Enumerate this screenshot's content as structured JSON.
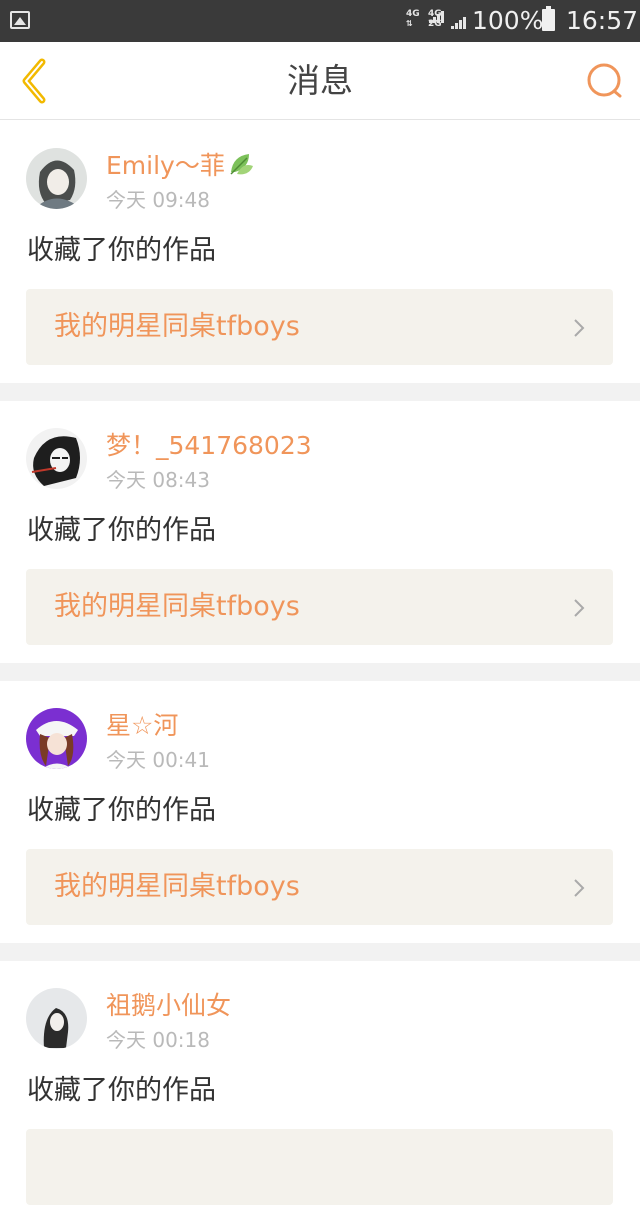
{
  "status_bar": {
    "network_1": "4G",
    "network_2_top": "4G",
    "network_2_bottom": "2G",
    "battery_percent": "100%",
    "time": "16:57",
    "icons": [
      "gallery-icon",
      "signal-icon",
      "battery-icon"
    ]
  },
  "header": {
    "title": "消息",
    "back_icon": "chevron-left-icon",
    "search_icon": "search-icon",
    "accent_color": "#f0955a",
    "back_color": "#f2b900"
  },
  "messages": [
    {
      "username": "Emily～菲",
      "username_emoji": "leaf-icon",
      "time": "今天 09:48",
      "action": "收藏了你的作品",
      "work_title": "我的明星同桌tfboys"
    },
    {
      "username": "梦！_541768023",
      "time": "今天 08:43",
      "action": "收藏了你的作品",
      "work_title": "我的明星同桌tfboys"
    },
    {
      "username": "星☆河",
      "time": "今天 00:41",
      "action": "收藏了你的作品",
      "work_title": "我的明星同桌tfboys"
    },
    {
      "username": "祖鹅小仙女",
      "time": "今天 00:18",
      "action": "收藏了你的作品",
      "work_title": ""
    }
  ]
}
